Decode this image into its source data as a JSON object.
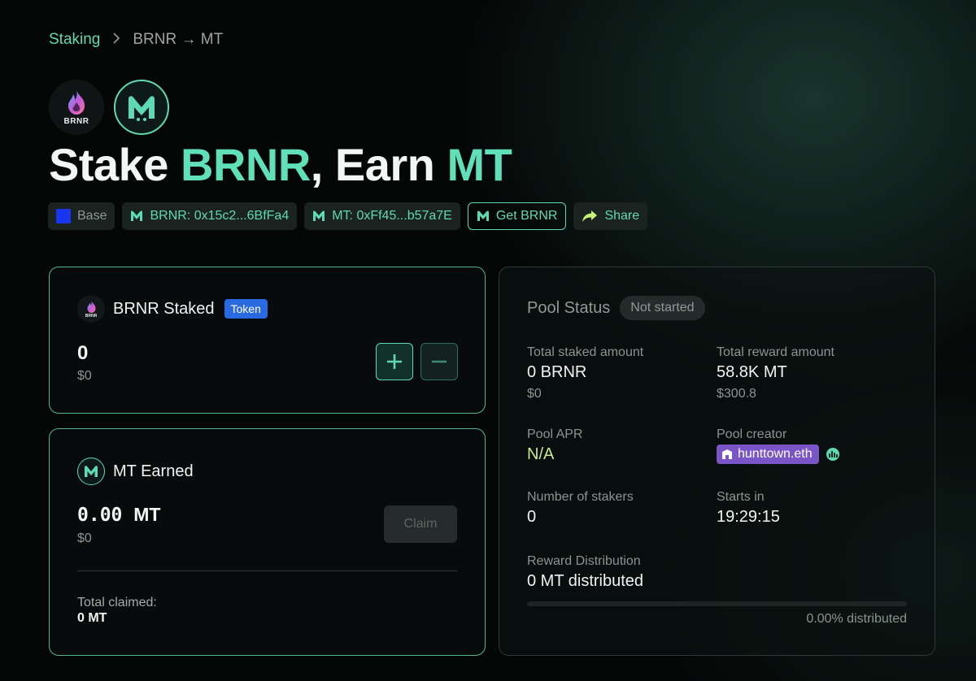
{
  "breadcrumb": {
    "root": "Staking",
    "current": "BRNR → MT"
  },
  "logos": {
    "brnr_word": "BRNR"
  },
  "title": {
    "prefix": "Stake ",
    "stake_token": "BRNR",
    "sep": ",",
    "mid": " Earn ",
    "earn_token": "MT"
  },
  "tags": {
    "network": "Base",
    "stake_contract": "BRNR: 0x15c2...6BfFa4",
    "reward_contract": "MT: 0xFf45...b57a7E",
    "get_button": "Get BRNR",
    "share_button": "Share"
  },
  "staked": {
    "title": "BRNR Staked",
    "badge": "Token",
    "amount": "0",
    "usd": "$0"
  },
  "earned": {
    "title": "MT Earned",
    "amount": "0.00",
    "unit": "MT",
    "usd": "$0",
    "claim_label": "Claim",
    "total_claimed_label": "Total claimed:",
    "total_claimed_value": "0 MT"
  },
  "pool": {
    "title": "Pool Status",
    "status": "Not started",
    "total_staked_label": "Total staked amount",
    "total_staked_value": "0 BRNR",
    "total_staked_usd": "$0",
    "total_reward_label": "Total reward amount",
    "total_reward_value": "58.8K MT",
    "total_reward_usd": "$300.8",
    "apr_label": "Pool APR",
    "apr_value": "N/A",
    "creator_label": "Pool creator",
    "creator_value": "hunttown.eth",
    "stakers_label": "Number of stakers",
    "stakers_value": "0",
    "starts_label": "Starts in",
    "starts_value": "19:29:15",
    "distribution_label": "Reward Distribution",
    "distribution_value": "0 MT distributed",
    "distribution_fraction": 0,
    "distribution_pct": "0.00% distributed"
  },
  "colors": {
    "accent": "#5fd9b3",
    "token_badge": "#2a6ae0",
    "creator_pill": "#7a55c8",
    "network": "#1a35f0"
  }
}
